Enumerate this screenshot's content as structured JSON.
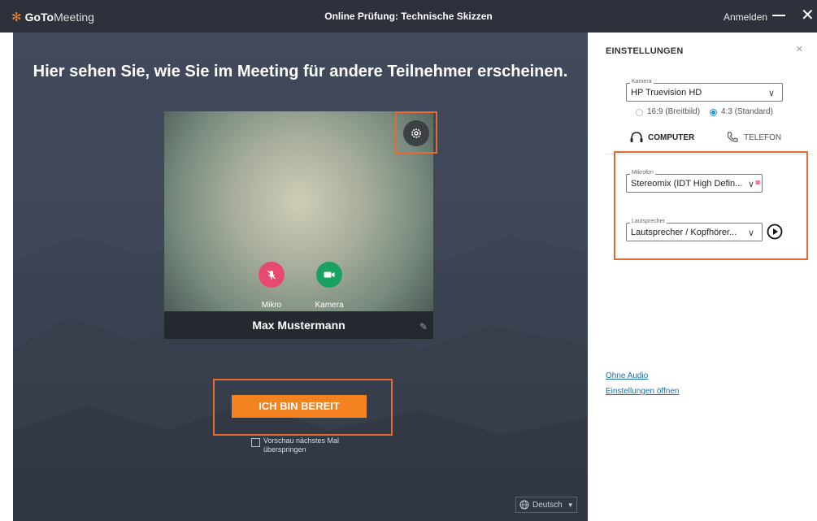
{
  "window": {
    "brand_bold": "GoTo",
    "brand_light": "Meeting",
    "title": "Online Prüfung: Technische Skizzen",
    "signin": "Anmelden",
    "minimize_glyph": "—",
    "close_glyph": "✕"
  },
  "stage": {
    "headline": "Hier sehen Sie, wie Sie im Meeting für andere Teilnehmer erscheinen.",
    "participant_name": "Max Mustermann",
    "mic_label": "Mikro",
    "camera_label": "Kamera",
    "ready_button": "ICH BIN BEREIT",
    "skip_preview": [
      "Vorschau nächstes Mal",
      "überspringen"
    ],
    "language": "Deutsch"
  },
  "settings": {
    "title": "EINSTELLUNGEN",
    "close_glyph": "×",
    "camera_legend": "Kamera",
    "camera_value": "HP Truevision HD",
    "aspect_wide": "16:9 (Breitbild)",
    "aspect_standard": "4:3 (Standard)",
    "aspect_selected": "4:3",
    "tab_computer": "COMPUTER",
    "tab_phone": "TELEFON",
    "mic_legend": "Mikrofon",
    "mic_value": "Stereomix (IDT High Defin...",
    "speaker_legend": "Lautsprecher",
    "speaker_value": "Lautsprecher / Kopfhörer...",
    "no_audio": "Ohne Audio",
    "open_settings": "Einstellungen öffnen"
  },
  "colors": {
    "accent_orange": "#f58220",
    "highlight_box": "#e8692d",
    "mic_red": "#e8496f",
    "camera_green": "#1aa161",
    "radio_blue": "#1a9bd7"
  }
}
